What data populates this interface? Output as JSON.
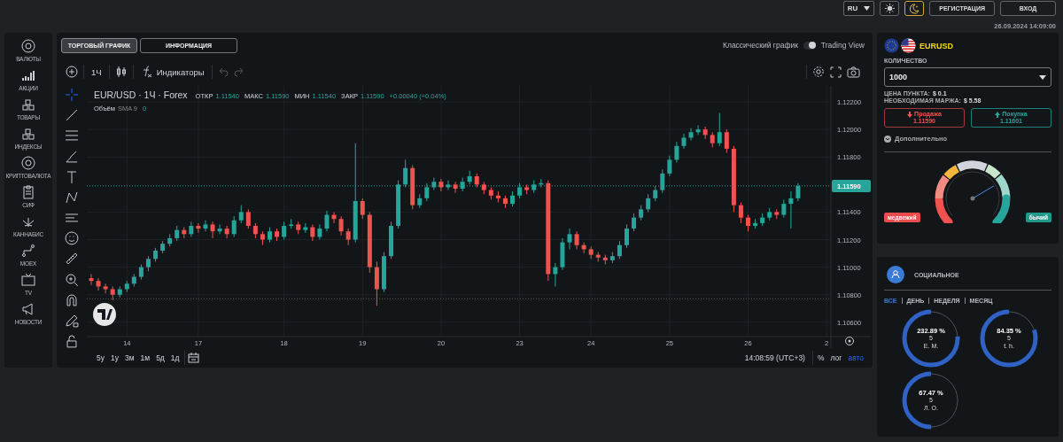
{
  "header": {
    "language": "RU",
    "theme_buttons": [
      {
        "kind": "light",
        "selected": false
      },
      {
        "kind": "dark",
        "selected": true
      }
    ],
    "register": "РЕГИСТРАЦИЯ",
    "login": "ВХОД",
    "datetime": "26.09.2024 14:09:00"
  },
  "sidebar": {
    "items": [
      {
        "label": "ВАЛЮТЫ",
        "kind": "coin"
      },
      {
        "label": "АКЦИИ",
        "kind": "bars"
      },
      {
        "label": "ТОВАРЫ",
        "kind": "boxes"
      },
      {
        "label": "ИНДЕКСЫ",
        "kind": "boxes"
      },
      {
        "label": "КРИПТОВАЛЮТА",
        "kind": "coin"
      },
      {
        "label": "CИФ",
        "kind": "clipboard"
      },
      {
        "label": "КАННАБИС",
        "kind": "leaf"
      },
      {
        "label": "MOEX",
        "kind": "route"
      },
      {
        "label": "TV",
        "kind": "tv"
      },
      {
        "label": "НОВОСТИ",
        "kind": "megaphone"
      }
    ]
  },
  "chart_panel": {
    "tabs": [
      {
        "label": "ТОРГОВЫЙ ГРАФИК",
        "selected": true
      },
      {
        "label": "ИНФОРМАЦИЯ",
        "selected": false
      }
    ],
    "view_toggle": {
      "left_label": "Классический график",
      "right_label": "Trading View",
      "on": true
    },
    "toolbar": {
      "interval": "1Ч",
      "indicators": "Индикаторы"
    },
    "legend": {
      "title": "EUR/USD · 1Ч · Forex",
      "values": [
        {
          "label": "ОТКР",
          "value": "1.11540"
        },
        {
          "label": "МАКС",
          "value": "1.11590"
        },
        {
          "label": "МИН",
          "value": "1.11540"
        },
        {
          "label": "ЗАКР",
          "value": "1.11590"
        }
      ],
      "change": "+0.00040 (+0.04%)",
      "volume_label": "Объём",
      "volume_study": "SMA 9",
      "volume_value": "0"
    },
    "chart_data": {
      "type": "candlestick",
      "ylim": [
        1.10496,
        1.12316
      ],
      "grid": true,
      "ref_lines": [
        {
          "axis": "y",
          "value": 1.1159,
          "label": "1.11590",
          "color": "#26a69a"
        },
        {
          "axis": "y",
          "value": 1.1077,
          "color": "#555555"
        }
      ],
      "yticks": [
        {
          "value": 1.122,
          "label": "1.12200"
        },
        {
          "value": 1.12,
          "label": "1.12000"
        },
        {
          "value": 1.118,
          "label": "1.11800"
        },
        {
          "value": 1.114,
          "label": "1.11400"
        },
        {
          "value": 1.112,
          "label": "1.11200"
        },
        {
          "value": 1.11,
          "label": "1.11000"
        },
        {
          "value": 1.108,
          "label": "1.10800"
        },
        {
          "value": 1.106,
          "label": "1.10600"
        }
      ],
      "categories": [
        null,
        null,
        null,
        null,
        null,
        "14",
        null,
        null,
        null,
        null,
        null,
        null,
        null,
        null,
        null,
        "17",
        null,
        null,
        null,
        null,
        null,
        null,
        null,
        null,
        null,
        null,
        null,
        "18",
        null,
        null,
        null,
        null,
        null,
        null,
        null,
        null,
        null,
        null,
        "19",
        null,
        null,
        null,
        null,
        null,
        null,
        null,
        null,
        null,
        null,
        "20",
        null,
        null,
        null,
        null,
        null,
        null,
        null,
        null,
        null,
        null,
        "23",
        null,
        null,
        null,
        null,
        null,
        null,
        null,
        null,
        null,
        "24",
        null,
        null,
        null,
        null,
        null,
        null,
        null,
        null,
        null,
        null,
        "25",
        null,
        null,
        null,
        null,
        null,
        null,
        null,
        null,
        null,
        null,
        "26",
        null,
        null,
        null,
        null,
        null,
        null,
        null,
        null,
        null,
        null,
        "2"
      ],
      "ohlc": [
        [
          1.1092,
          1.1095,
          1.1087,
          1.109
        ],
        [
          1.109,
          1.1092,
          1.1083,
          1.1086
        ],
        [
          1.1086,
          1.1088,
          1.1081,
          1.1084
        ],
        [
          1.1084,
          1.1086,
          1.1076,
          1.108
        ],
        [
          1.108,
          1.1086,
          1.1078,
          1.1084
        ],
        [
          1.1084,
          1.109,
          1.1082,
          1.1088
        ],
        [
          1.1088,
          1.1095,
          1.1086,
          1.1093
        ],
        [
          1.1093,
          1.1102,
          1.1091,
          1.11
        ],
        [
          1.11,
          1.1108,
          1.1097,
          1.1106
        ],
        [
          1.1106,
          1.1114,
          1.1104,
          1.1112
        ],
        [
          1.1112,
          1.1119,
          1.111,
          1.1117
        ],
        [
          1.1117,
          1.1124,
          1.1115,
          1.1121
        ],
        [
          1.1121,
          1.113,
          1.1119,
          1.1127
        ],
        [
          1.1127,
          1.1129,
          1.1121,
          1.1124
        ],
        [
          1.1124,
          1.1133,
          1.1122,
          1.113
        ],
        [
          1.113,
          1.1132,
          1.1125,
          1.1128
        ],
        [
          1.1128,
          1.1134,
          1.1126,
          1.1131
        ],
        [
          1.1131,
          1.1133,
          1.1121,
          1.1126
        ],
        [
          1.1126,
          1.1131,
          1.1124,
          1.1128
        ],
        [
          1.1128,
          1.113,
          1.1121,
          1.1124
        ],
        [
          1.1124,
          1.1137,
          1.1122,
          1.1134
        ],
        [
          1.1134,
          1.1145,
          1.1132,
          1.114
        ],
        [
          1.114,
          1.1142,
          1.1128,
          1.113
        ],
        [
          1.113,
          1.1132,
          1.1121,
          1.1124
        ],
        [
          1.1124,
          1.1126,
          1.1116,
          1.112
        ],
        [
          1.112,
          1.1129,
          1.1118,
          1.1126
        ],
        [
          1.1126,
          1.1128,
          1.1119,
          1.1122
        ],
        [
          1.1122,
          1.1133,
          1.112,
          1.113
        ],
        [
          1.113,
          1.1135,
          1.1128,
          1.1131
        ],
        [
          1.1131,
          1.1133,
          1.1124,
          1.1127
        ],
        [
          1.1127,
          1.1132,
          1.1125,
          1.1129
        ],
        [
          1.1129,
          1.1131,
          1.1119,
          1.1122
        ],
        [
          1.1122,
          1.1131,
          1.112,
          1.1128
        ],
        [
          1.1128,
          1.1141,
          1.1126,
          1.1138
        ],
        [
          1.1138,
          1.114,
          1.1132,
          1.1135
        ],
        [
          1.1135,
          1.1137,
          1.1123,
          1.1126
        ],
        [
          1.1126,
          1.1128,
          1.1116,
          1.112
        ],
        [
          1.112,
          1.119,
          1.1118,
          1.1148
        ],
        [
          1.1148,
          1.115,
          1.1135,
          1.1138
        ],
        [
          1.1138,
          1.114,
          1.1096,
          1.11
        ],
        [
          1.11,
          1.1104,
          1.1072,
          1.1084
        ],
        [
          1.1084,
          1.1111,
          1.1082,
          1.1108
        ],
        [
          1.1108,
          1.1133,
          1.1106,
          1.113
        ],
        [
          1.113,
          1.1163,
          1.1128,
          1.116
        ],
        [
          1.116,
          1.1178,
          1.1158,
          1.1172
        ],
        [
          1.1172,
          1.1174,
          1.1142,
          1.1145
        ],
        [
          1.1145,
          1.1153,
          1.1143,
          1.115
        ],
        [
          1.115,
          1.1161,
          1.1148,
          1.1158
        ],
        [
          1.1158,
          1.1165,
          1.1156,
          1.1162
        ],
        [
          1.1162,
          1.1164,
          1.1155,
          1.1158
        ],
        [
          1.1158,
          1.1163,
          1.1156,
          1.116
        ],
        [
          1.116,
          1.1162,
          1.1154,
          1.1157
        ],
        [
          1.1157,
          1.1165,
          1.1155,
          1.1162
        ],
        [
          1.1162,
          1.117,
          1.116,
          1.1166
        ],
        [
          1.1166,
          1.1168,
          1.1158,
          1.116
        ],
        [
          1.116,
          1.1162,
          1.1153,
          1.1156
        ],
        [
          1.1156,
          1.1158,
          1.1149,
          1.1152
        ],
        [
          1.1152,
          1.1155,
          1.1147,
          1.115
        ],
        [
          1.115,
          1.1152,
          1.1143,
          1.1146
        ],
        [
          1.1146,
          1.1155,
          1.1144,
          1.1152
        ],
        [
          1.1152,
          1.1161,
          1.115,
          1.1158
        ],
        [
          1.1158,
          1.116,
          1.1153,
          1.1156
        ],
        [
          1.1156,
          1.1163,
          1.1154,
          1.116
        ],
        [
          1.116,
          1.1164,
          1.1158,
          1.1161
        ],
        [
          1.1161,
          1.1163,
          1.109,
          1.1095
        ],
        [
          1.1095,
          1.1103,
          1.1086,
          1.11
        ],
        [
          1.11,
          1.1121,
          1.1098,
          1.1118
        ],
        [
          1.1118,
          1.1128,
          1.1113,
          1.1124
        ],
        [
          1.1124,
          1.1126,
          1.1113,
          1.1116
        ],
        [
          1.1116,
          1.1118,
          1.111,
          1.1113
        ],
        [
          1.1113,
          1.1115,
          1.1106,
          1.1109
        ],
        [
          1.1109,
          1.1111,
          1.1104,
          1.1107
        ],
        [
          1.1107,
          1.1109,
          1.1102,
          1.1105
        ],
        [
          1.1105,
          1.1111,
          1.1103,
          1.1108
        ],
        [
          1.1108,
          1.1119,
          1.1106,
          1.1116
        ],
        [
          1.1116,
          1.1131,
          1.1114,
          1.1128
        ],
        [
          1.1128,
          1.1139,
          1.1126,
          1.1136
        ],
        [
          1.1136,
          1.1145,
          1.1134,
          1.1142
        ],
        [
          1.1142,
          1.1153,
          1.114,
          1.115
        ],
        [
          1.115,
          1.1159,
          1.1148,
          1.1156
        ],
        [
          1.1156,
          1.1171,
          1.1154,
          1.1168
        ],
        [
          1.1168,
          1.1181,
          1.1166,
          1.1178
        ],
        [
          1.1178,
          1.1191,
          1.1176,
          1.1188
        ],
        [
          1.1188,
          1.1197,
          1.1186,
          1.1194
        ],
        [
          1.1194,
          1.1201,
          1.1192,
          1.1198
        ],
        [
          1.1198,
          1.1203,
          1.1196,
          1.12
        ],
        [
          1.12,
          1.1202,
          1.1193,
          1.1196
        ],
        [
          1.1196,
          1.1198,
          1.1187,
          1.119
        ],
        [
          1.119,
          1.1212,
          1.1188,
          1.1198
        ],
        [
          1.1198,
          1.12,
          1.1183,
          1.1186
        ],
        [
          1.1186,
          1.1188,
          1.114,
          1.1145
        ],
        [
          1.1145,
          1.1147,
          1.1132,
          1.1136
        ],
        [
          1.1136,
          1.1138,
          1.1126,
          1.113
        ],
        [
          1.113,
          1.1135,
          1.1128,
          1.1132
        ],
        [
          1.1132,
          1.1139,
          1.113,
          1.1136
        ],
        [
          1.1136,
          1.1143,
          1.1134,
          1.114
        ],
        [
          1.114,
          1.1142,
          1.1135,
          1.1138
        ],
        [
          1.1138,
          1.1149,
          1.1136,
          1.1146
        ],
        [
          1.1146,
          1.1155,
          1.1128,
          1.115
        ],
        [
          1.115,
          1.1161,
          1.1148,
          1.1159
        ],
        null,
        null,
        null,
        null
      ]
    },
    "ranges": [
      "5y",
      "1y",
      "3м",
      "1м",
      "5д",
      "1д"
    ],
    "clock": "14:08:59 (UTC+3)",
    "scale_options": [
      {
        "label": "%",
        "selected": false
      },
      {
        "label": "лог",
        "selected": false
      },
      {
        "label": "авто",
        "selected": true
      }
    ]
  },
  "trade_panel": {
    "symbol": "EURUSD",
    "quantity_label": "КОЛИЧЕСТВО",
    "quantity": "1000",
    "pip_price_label": "ЦЕНА ПУНКТА:",
    "pip_price": "$ 0.1",
    "margin_label": "НЕОБХОДИМАЯ МАРЖА:",
    "margin": "$ 5.58",
    "sell": {
      "label": "Продажа",
      "price": "1.11590"
    },
    "buy": {
      "label": "Покупка",
      "price": "1.11601"
    },
    "more": "Дополнительно",
    "sentiment": {
      "level": 0.72,
      "bear_label": "медвежий",
      "bull_label": "бычий"
    }
  },
  "social": {
    "title": "СОЦИАЛЬНОЕ",
    "filters": [
      {
        "label": "ВСЕ",
        "selected": true
      },
      {
        "label": "ДЕНЬ",
        "selected": false
      },
      {
        "label": "НЕДЕЛЯ",
        "selected": false
      },
      {
        "label": "МЕСЯЦ",
        "selected": false
      }
    ],
    "traders": [
      {
        "percent": "232.89 %",
        "count": "5",
        "name": "Е. М.",
        "level": 0.76
      },
      {
        "percent": "84.35 %",
        "count": "5",
        "name": "t. h.",
        "level": 0.8
      },
      {
        "percent": "67.47 %",
        "count": "5",
        "name": "Л. О.",
        "level": 0.5
      }
    ]
  }
}
